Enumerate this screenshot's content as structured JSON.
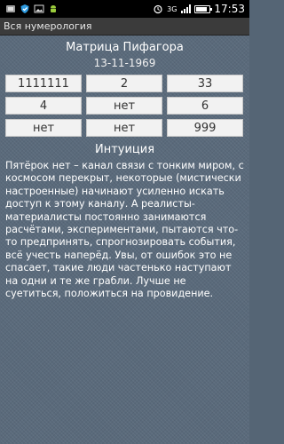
{
  "status_bar": {
    "time": "17:53",
    "network": "3G",
    "battery_level": 0.8,
    "icons": [
      "notification-icon",
      "shield-icon",
      "image-icon",
      "android-icon",
      "alarm-icon",
      "signal-icon",
      "battery-icon"
    ]
  },
  "app": {
    "title": "Вся нумерология"
  },
  "matrix": {
    "title": "Матрица Пифагора",
    "date": "13-11-1969",
    "cells": [
      "1111111",
      "2",
      "33",
      "4",
      "нет",
      "6",
      "нет",
      "нет",
      "999"
    ]
  },
  "section": {
    "title": "Интуиция",
    "text": "Пятёрок нет – канал связи с тонким миром, с космосом перекрыт, некоторые (мистически настроенные) начинают усиленно искать доступ к этому каналу. А реалисты-материалисты постоянно занимаются расчётами, экспериментами, пытаются что-то предпринять, спрогнозировать события, всё учесть наперёд. Увы, от ошибок это не спасает, такие люди частенько наступают на одни и те же грабли. Лучше не суетиться, положиться на провидение."
  }
}
